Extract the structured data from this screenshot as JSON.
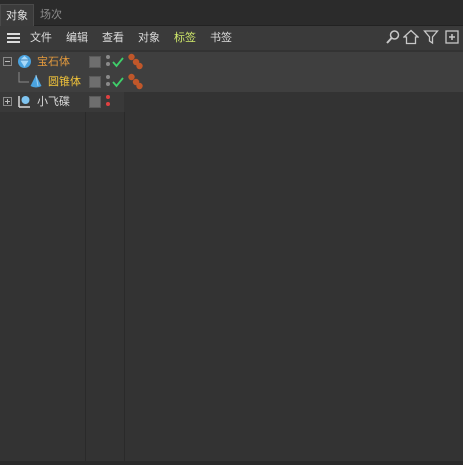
{
  "tabs": [
    {
      "label": "对象",
      "active": true
    },
    {
      "label": "场次",
      "active": false
    }
  ],
  "menu": [
    {
      "label": "文件"
    },
    {
      "label": "编辑"
    },
    {
      "label": "查看"
    },
    {
      "label": "对象"
    },
    {
      "label": "标签",
      "active": true
    },
    {
      "label": "书签"
    }
  ],
  "toolbar_icons": [
    "search-icon",
    "home-icon",
    "filter-icon",
    "new-window-icon"
  ],
  "objects": [
    {
      "name": "宝石体",
      "icon": "gem-object-icon",
      "color": "#e39a3d",
      "selected": true,
      "expanded": true,
      "enabled": true,
      "tag": "material-spheres-icon"
    },
    {
      "name": "圆锥体",
      "icon": "cone-object-icon",
      "color": "#f2c43a",
      "selected": true,
      "child": true,
      "enabled": true,
      "tag": "material-spheres-icon"
    },
    {
      "name": "小飞碟",
      "icon": "light-object-icon",
      "color": "#dadada",
      "selected": false,
      "expanded": false,
      "enabled": false
    }
  ],
  "colors": {
    "accent_menu": "#cfe86a",
    "check": "#3fcf6a",
    "disabled_dot": "#e04040",
    "material": "#c0572a"
  }
}
